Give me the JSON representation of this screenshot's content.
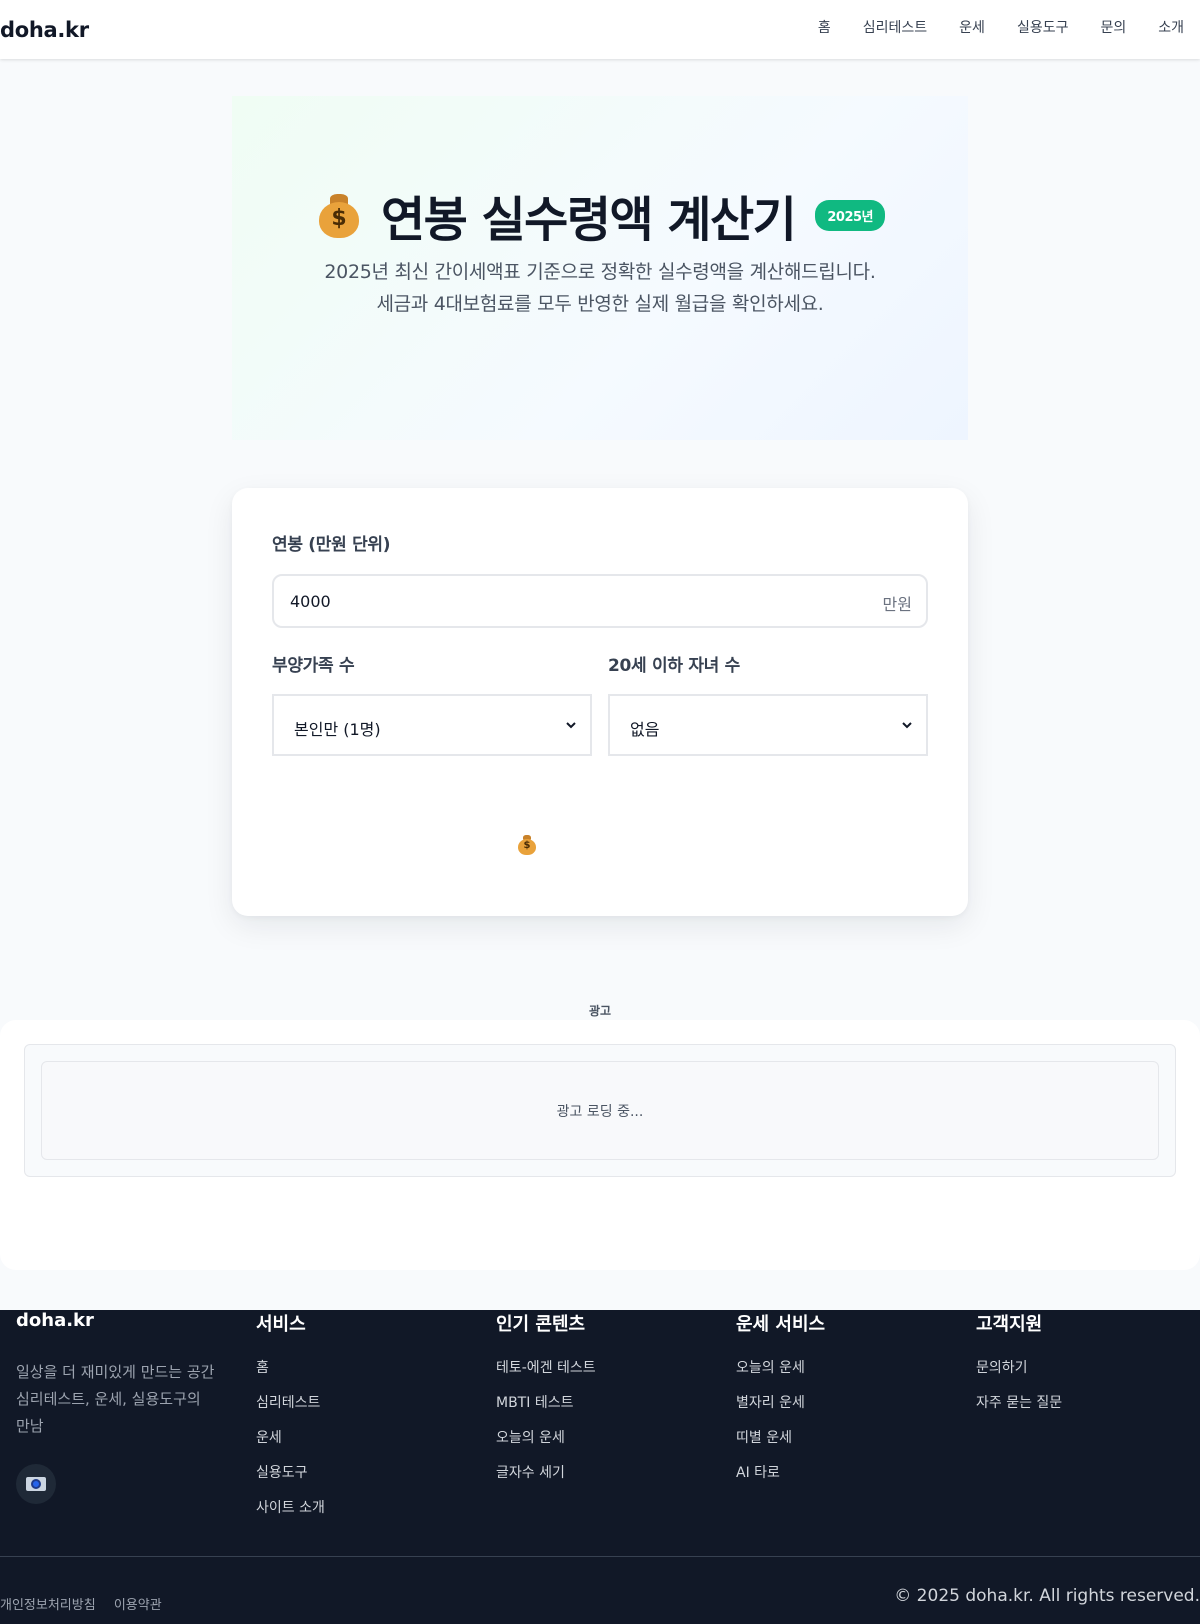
{
  "header": {
    "logo": "doha.kr",
    "nav": [
      "홈",
      "심리테스트",
      "운세",
      "실용도구",
      "문의",
      "소개"
    ]
  },
  "hero": {
    "title": "연봉 실수령액 계산기",
    "badge": "2025년",
    "subtitle_line1": "2025년 최신 간이세액표 기준으로 정확한 실수령액을 계산해드립니다.",
    "subtitle_line2": "세금과 4대보험료를 모두 반영한 실제 월급을 확인하세요.",
    "emoji": "money-bag-icon"
  },
  "calculator": {
    "salary_label": "연봉 (만원 단위)",
    "salary_value": "4000",
    "salary_unit": "만원",
    "dependents_label": "부양가족 수",
    "dependents_value": "본인만 (1명)",
    "children_label": "20세 이하 자녀 수",
    "children_value": "없음"
  },
  "ad": {
    "label": "광고",
    "loading": "광고 로딩 중..."
  },
  "footer": {
    "brand": "doha.kr",
    "desc_line1": "일상을 더 재미있게 만드는 공간",
    "desc_line2": "심리테스트, 운세, 실용도구의",
    "desc_line3": "만남",
    "columns": [
      {
        "title": "서비스",
        "items": [
          "홈",
          "심리테스트",
          "운세",
          "실용도구",
          "사이트 소개"
        ]
      },
      {
        "title": "인기 콘텐츠",
        "items": [
          "테토-에겐 테스트",
          "MBTI 테스트",
          "오늘의 운세",
          "글자수 세기"
        ]
      },
      {
        "title": "운세 서비스",
        "items": [
          "오늘의 운세",
          "별자리 운세",
          "띠별 운세",
          "AI 타로"
        ]
      },
      {
        "title": "고객지원",
        "items": [
          "문의하기",
          "자주 묻는 질문"
        ]
      }
    ],
    "legal": [
      "개인정보처리방침",
      "이용약관"
    ],
    "copyright": "© 2025 doha.kr. All rights reserved."
  },
  "colors": {
    "accent": "#10b981",
    "footer_bg": "#111827",
    "page_bg": "#f8fafc"
  }
}
